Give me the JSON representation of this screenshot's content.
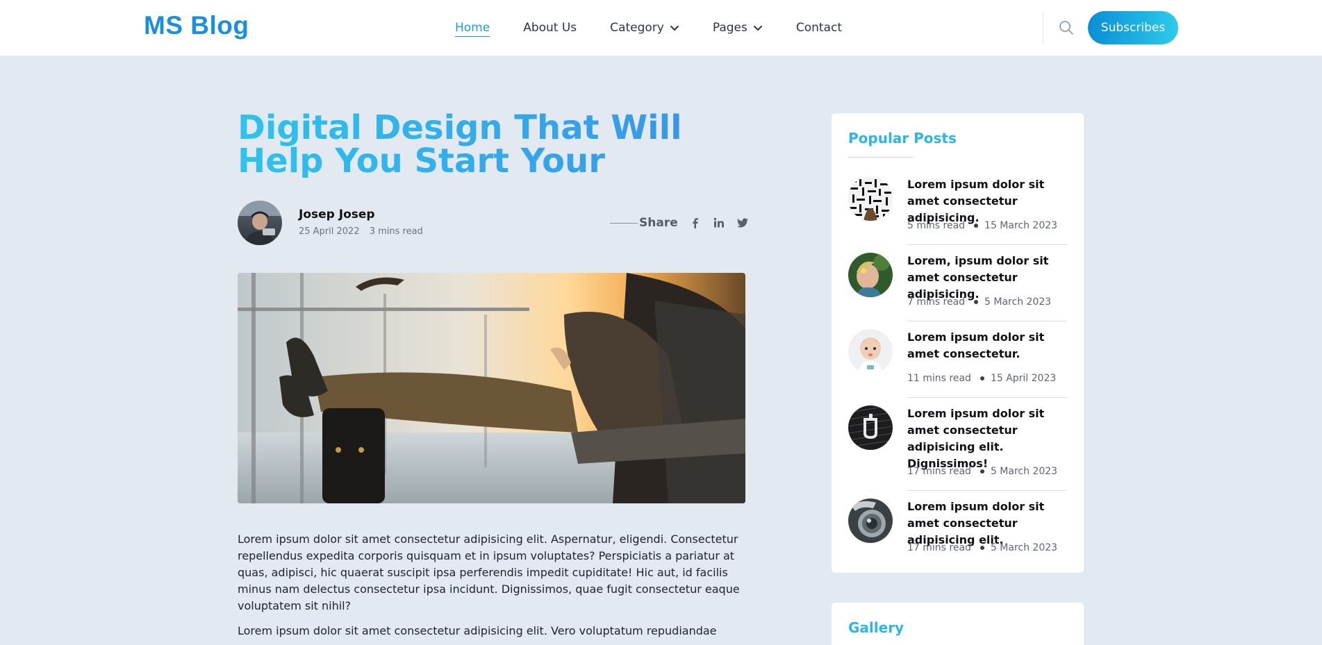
{
  "header": {
    "logo": "MS Blog",
    "nav": [
      {
        "label": "Home",
        "active": true,
        "dropdown": false
      },
      {
        "label": "About Us",
        "active": false,
        "dropdown": false
      },
      {
        "label": "Category",
        "active": false,
        "dropdown": true
      },
      {
        "label": "Pages",
        "active": false,
        "dropdown": true
      },
      {
        "label": "Contact",
        "active": false,
        "dropdown": false
      }
    ],
    "subscribe_label": "Subscribes",
    "search_icon": "search-icon"
  },
  "article": {
    "title": "Digital Design That Will Help You Start Your",
    "author": {
      "name": "Josep Josep",
      "date": "25 April 2022",
      "read_time": "3 mins read"
    },
    "share_label": "Share",
    "social": [
      "facebook-icon",
      "linkedin-icon",
      "twitter-icon"
    ],
    "paragraphs": [
      "Lorem ipsum dolor sit amet consectetur adipisicing elit. Aspernatur, eligendi. Consectetur repellendus expedita corporis quisquam et in ipsum voluptates? Perspiciatis a pariatur at quas, adipisci, hic quaerat suscipit ipsa perferendis impedit cupiditate! Hic aut, id facilis minus nam delectus consectetur ipsa incidunt. Dignissimos, quae fugit consectetur eaque voluptatem sit nihil?",
      "Lorem ipsum dolor sit amet consectetur adipisicing elit. Vero voluptatum repudiandae"
    ]
  },
  "sidebar": {
    "popular_title": "Popular Posts",
    "posts": [
      {
        "title": "Lorem ipsum dolor sit amet consectetur adipisicing.",
        "read": "5 mins read",
        "date": "15 March 2023"
      },
      {
        "title": "Lorem, ipsum dolor sit amet consectetur adipisicing.",
        "read": "7 mins read",
        "date": "5 March 2023"
      },
      {
        "title": "Lorem ipsum dolor sit amet consectetur.",
        "read": "11 mins read",
        "date": "15 April 2023"
      },
      {
        "title": "Lorem ipsum dolor sit amet consectetur adipisicing elit. Dignissimos!",
        "read": "17 mins read",
        "date": "5 March 2023"
      },
      {
        "title": "Lorem ipsum dolor sit amet consectetur adipisicing elit.",
        "read": "17 mins read",
        "date": "5 March 2023"
      }
    ],
    "gallery_title": "Gallery"
  },
  "colors": {
    "accent": "#1c9bd9",
    "title_gradient_start": "#2ec3ec",
    "title_gradient_end": "#3a8fe6",
    "page_bg": "#e3e9f1"
  }
}
